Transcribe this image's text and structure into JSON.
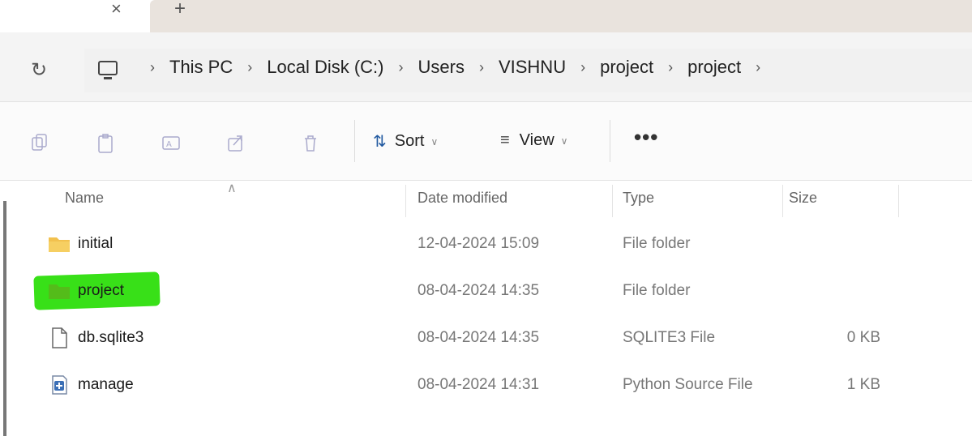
{
  "tabstrip": {
    "close_glyph": "×",
    "new_tab_glyph": "+"
  },
  "address": {
    "refresh_icon": "refresh-icon",
    "pc_icon": "computer-icon",
    "breadcrumbs": [
      "This PC",
      "Local Disk (C:)",
      "Users",
      "VISHNU",
      "project",
      "project"
    ]
  },
  "toolbar": {
    "icons": [
      "copy-icon",
      "paste-icon",
      "rename-icon",
      "share-icon",
      "delete-icon"
    ],
    "sort_label": "Sort",
    "view_label": "View",
    "more_label": "•••"
  },
  "columns": {
    "name": "Name",
    "date": "Date modified",
    "type": "Type",
    "size": "Size"
  },
  "files": [
    {
      "name": "initial",
      "date": "12-04-2024 15:09",
      "type": "File folder",
      "size": "",
      "icon": "folder-icon"
    },
    {
      "name": "project",
      "date": "08-04-2024 14:35",
      "type": "File folder",
      "size": "",
      "icon": "folder-icon",
      "highlighted": true,
      "highlight_color": "#38e018"
    },
    {
      "name": "db.sqlite3",
      "date": "08-04-2024 14:35",
      "type": "SQLITE3 File",
      "size": "0 KB",
      "icon": "file-icon"
    },
    {
      "name": "manage",
      "date": "08-04-2024 14:31",
      "type": "Python Source File",
      "size": "1 KB",
      "icon": "python-file-icon"
    }
  ],
  "colors": {
    "folder": "#f2c14e",
    "highlight": "#38e018",
    "accent": "#0067c0"
  }
}
